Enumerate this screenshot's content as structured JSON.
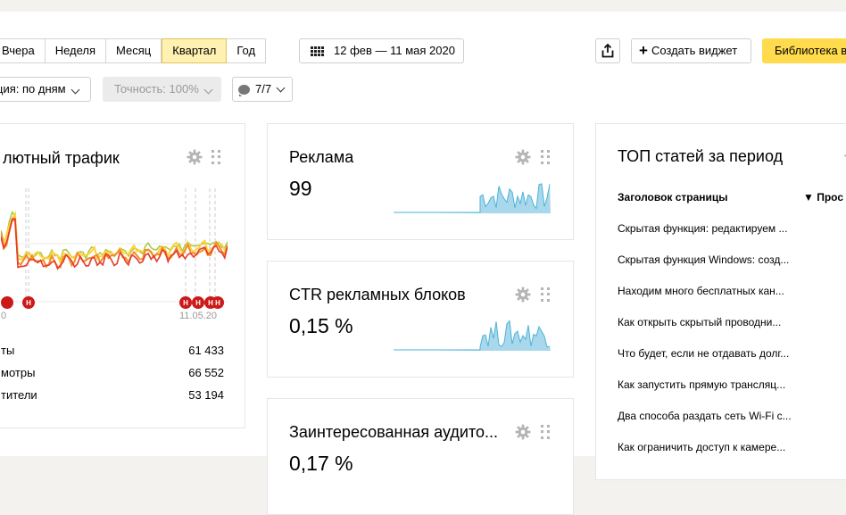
{
  "toolbar": {
    "periods": [
      "Вчера",
      "Неделя",
      "Месяц",
      "Квартал",
      "Год"
    ],
    "active_period": "Квартал",
    "date_range": "12 фев — 11 мая 2020",
    "create_widget": "Создать виджет",
    "library": "Библиотека в",
    "detail": "ция: по дням",
    "accuracy": "Точность: 100%",
    "segments": "7/7"
  },
  "traffic_card": {
    "title": "лютный трафик",
    "date_left": "0",
    "date_right": "11.05.20",
    "marker_label": "Н",
    "legend": [
      {
        "label": "ты",
        "value": "61 433"
      },
      {
        "label": "мотры",
        "value": "66 552"
      },
      {
        "label": "тители",
        "value": "53 194"
      }
    ],
    "colors": {
      "orange": "#f28c28",
      "red": "#e53b2c",
      "yellow": "#ffd23a",
      "green": "#a6c83c",
      "marker": "#cc1a1a"
    }
  },
  "ads_card": {
    "title": "Реклама",
    "value": "99"
  },
  "ctr_card": {
    "title": "CTR рекламных блоков",
    "value": "0,15 %"
  },
  "audience_card": {
    "title": "Заинтересованная аудито...",
    "value": "0,17 %"
  },
  "top_card": {
    "title": "ТОП статей за период",
    "col_title": "Заголовок страницы",
    "col_views": "▼ Прос",
    "items": [
      "Скрытая функция: редактируем ...",
      "Скрытая функция Windows: созд...",
      "Находим много бесплатных кан...",
      "Как открыть скрытый проводни...",
      "Что будет, если не отдавать долг...",
      "Как запустить прямую трансляц...",
      "Два способа раздать сеть Wi-Fi c...",
      "Как ограничить доступ к камере..."
    ]
  }
}
